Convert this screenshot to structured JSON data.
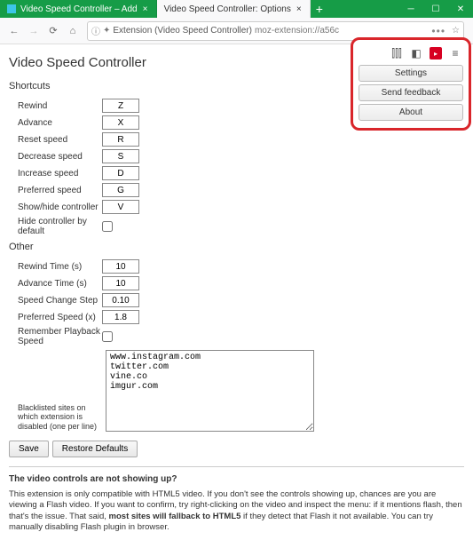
{
  "window": {
    "tabs": [
      {
        "title": "Video Speed Controller – Add",
        "active": false
      },
      {
        "title": "Video Speed Controller: Options",
        "active": true
      }
    ]
  },
  "urlbar": {
    "prefix": "Extension (Video Speed Controller)",
    "path": "moz-extension://a56c"
  },
  "popup": {
    "settings": "Settings",
    "feedback": "Send feedback",
    "about": "About"
  },
  "page": {
    "title": "Video Speed Controller",
    "section_shortcuts": "Shortcuts",
    "section_other": "Other",
    "shortcuts": {
      "rewind": {
        "label": "Rewind",
        "key": "Z"
      },
      "advance": {
        "label": "Advance",
        "key": "X"
      },
      "reset": {
        "label": "Reset speed",
        "key": "R"
      },
      "decrease": {
        "label": "Decrease speed",
        "key": "S"
      },
      "increase": {
        "label": "Increase speed",
        "key": "D"
      },
      "preferred": {
        "label": "Preferred speed",
        "key": "G"
      },
      "toggle": {
        "label": "Show/hide controller",
        "key": "V"
      },
      "hide_default": {
        "label": "Hide controller by default"
      }
    },
    "other": {
      "rewind_time": {
        "label": "Rewind Time (s)",
        "value": "10"
      },
      "advance_time": {
        "label": "Advance Time (s)",
        "value": "10"
      },
      "step": {
        "label": "Speed Change Step",
        "value": "0.10"
      },
      "pref_speed": {
        "label": "Preferred Speed (x)",
        "value": "1.8"
      },
      "remember": {
        "label": "Remember Playback Speed"
      },
      "blacklist_label": "Blacklisted sites on which extension is disabled (one per line)",
      "blacklist": "www.instagram.com\ntwitter.com\nvine.co\nimgur.com"
    },
    "buttons": {
      "save": "Save",
      "restore": "Restore Defaults"
    },
    "help": {
      "title": "The video controls are not showing up?",
      "p1a": "This extension is only compatible with HTML5 video. If you don't see the controls showing up, chances are you are viewing a Flash video. If you want to confirm, try right-clicking on the video and inspect the menu: if it mentions flash, then that's the issue. That said, ",
      "p1bold": "most sites will fallback to HTML5",
      "p1b": " if they detect that Flash it not available. You can try manually disabling Flash plugin in browser."
    }
  }
}
